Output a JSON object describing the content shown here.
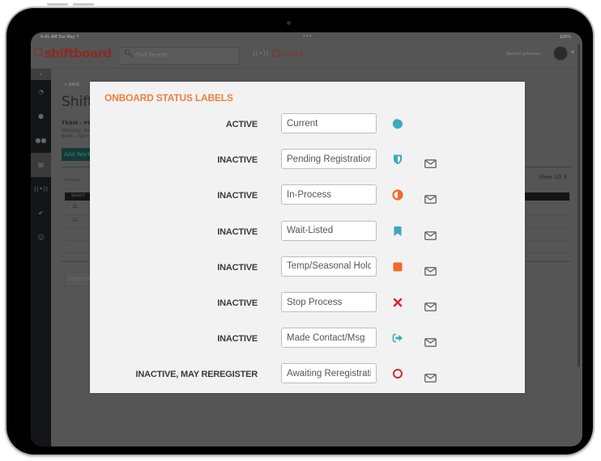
{
  "statusbar": {
    "time": "9:41 AM  Tue May 7",
    "dots": "•••",
    "battery": "100%"
  },
  "topbar": {
    "logo": "shiftboard",
    "search_placeholder": "Find People",
    "clock_in": "Clock In",
    "user_name": "Rachel Johnson"
  },
  "background_page": {
    "back_link": "< BACK",
    "title": "Shift S",
    "team": "TEAM - PR",
    "date_line1": "Monday, Au",
    "date_line2": "6am - 3pm",
    "add_button": "Add Work",
    "count": "4 Count",
    "view_select": "View 10 ⇕",
    "table_header": "SELECT",
    "select_input": "Select W"
  },
  "modal": {
    "title": "ONBOARD STATUS LABELS",
    "rows": [
      {
        "category": "ACTIVE",
        "value": "Current",
        "icon": "badge-icon",
        "icon_color": "#3ba8c0",
        "has_email": false
      },
      {
        "category": "INACTIVE",
        "value": "Pending Registration",
        "icon": "shield-icon",
        "icon_color": "#3ba8c0",
        "has_email": true
      },
      {
        "category": "INACTIVE",
        "value": "In-Process",
        "icon": "half-circle-icon",
        "icon_color": "#f06a28",
        "has_email": true
      },
      {
        "category": "INACTIVE",
        "value": "Wait-Listed",
        "icon": "bookmark-icon",
        "icon_color": "#3ba8c0",
        "has_email": true
      },
      {
        "category": "INACTIVE",
        "value": "Temp/Seasonal Hold",
        "icon": "square-icon",
        "icon_color": "#f06a28",
        "has_email": true
      },
      {
        "category": "INACTIVE",
        "value": "Stop Process",
        "icon": "x-mark-icon",
        "icon_color": "#d9272e",
        "has_email": true
      },
      {
        "category": "INACTIVE",
        "value": "Made Contact/Msg",
        "icon": "sign-out-icon",
        "icon_color": "#3ba8c0",
        "has_email": true
      },
      {
        "category": "INACTIVE, MAY REREGISTER",
        "value": "Awaiting Reregistration",
        "icon": "circle-outline-icon",
        "icon_color": "#d9272e",
        "has_email": true
      }
    ]
  }
}
